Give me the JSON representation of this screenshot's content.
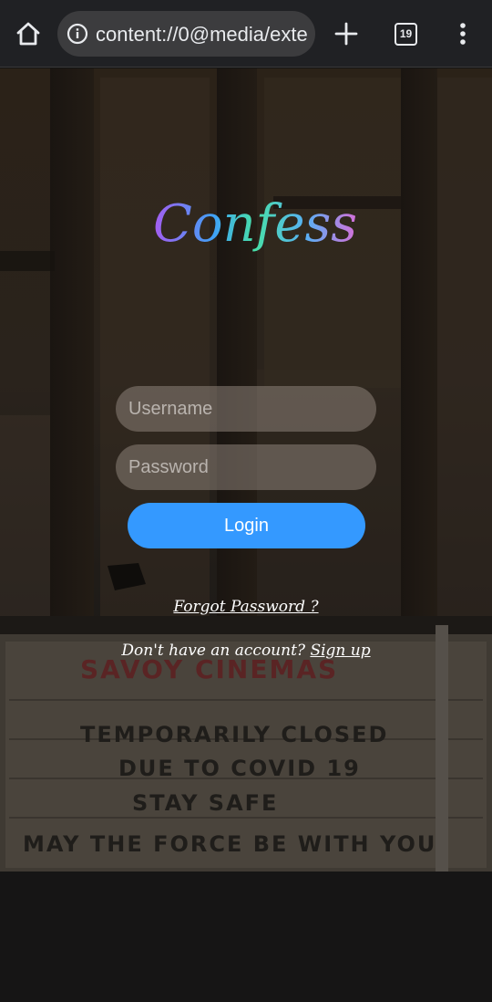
{
  "browser": {
    "url": "content://0@media/external/file/...",
    "tab_count": "19"
  },
  "scene": {
    "marquee_lines": [
      "SAVOY CINEMAS",
      "TEMPORARILY  CLOSED",
      "DUE  TO  COVID 19",
      "STAY    SAFE",
      "MAY  THE  FORCE  BE  WITH  YOU"
    ]
  },
  "login": {
    "logo_text": "Confess",
    "username_placeholder": "Username",
    "password_placeholder": "Password",
    "login_label": "Login",
    "forgot_label": "Forgot Password ?",
    "signup_prompt": "Don't have an account? ",
    "signup_label": "Sign up"
  },
  "colors": {
    "accent": "#3499ff",
    "logo_gradient": [
      "#a55cf0",
      "#3fa2f6",
      "#48e0a8",
      "#58b0f4",
      "#d66fd8"
    ]
  },
  "icons": [
    "home-icon",
    "info-icon",
    "plus-icon",
    "tab-switcher-icon",
    "more-vert-icon"
  ]
}
